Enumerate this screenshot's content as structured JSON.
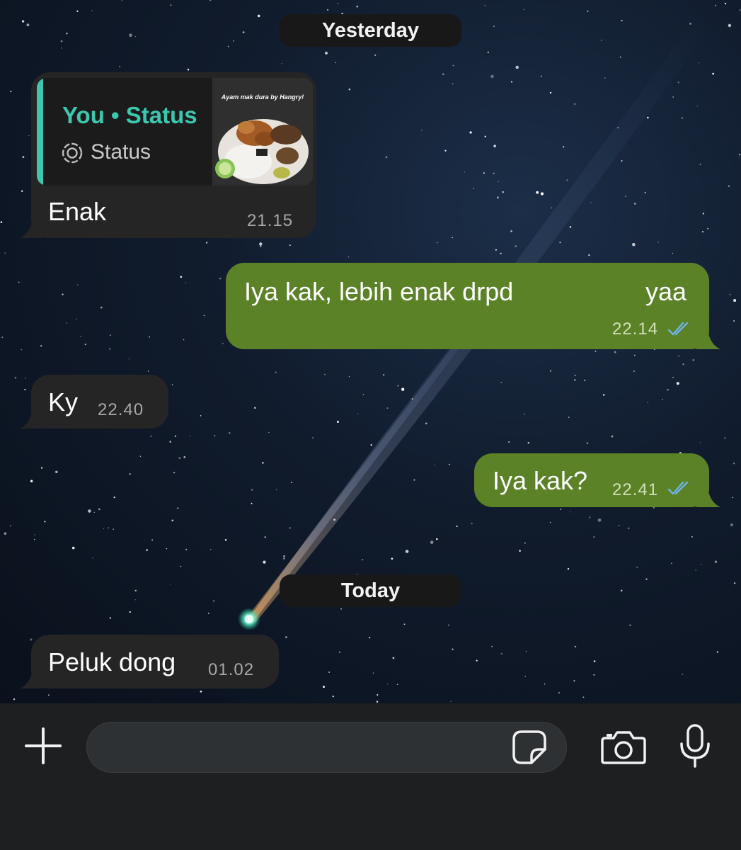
{
  "separators": {
    "yesterday": "Yesterday",
    "today": "Today"
  },
  "messages": [
    {
      "direction": "incoming",
      "quote": {
        "author": "You • Status",
        "type": "Status",
        "thumbnail_caption": "Ayam mak dura by Hangry!"
      },
      "text": "Enak",
      "time": "21.15"
    },
    {
      "direction": "outgoing",
      "text": "Iya kak, lebih enak drpd",
      "text_end": "yaa",
      "time": "22.14",
      "status": "read"
    },
    {
      "direction": "incoming",
      "text": "Ky",
      "time": "22.40"
    },
    {
      "direction": "outgoing",
      "text": "Iya kak?",
      "time": "22.41",
      "status": "read"
    },
    {
      "direction": "incoming",
      "text": "Peluk dong",
      "time": "01.02"
    }
  ],
  "composer": {
    "icons": [
      "plus-icon",
      "sticker-icon",
      "camera-icon",
      "microphone-icon"
    ]
  },
  "colors": {
    "incoming_bubble": "#252526",
    "outgoing_bubble": "#5b8227",
    "quote_accent": "#3cc7ae",
    "read_ticks": "#6fb3e8",
    "separator_pill": "#181818"
  }
}
